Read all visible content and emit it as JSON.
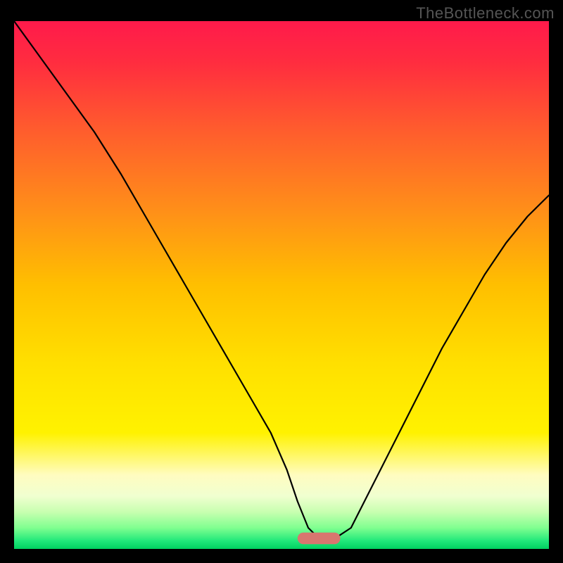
{
  "watermark": "TheBottleneck.com",
  "chart_data": {
    "type": "line",
    "title": "",
    "xlabel": "",
    "ylabel": "",
    "xlim": [
      0,
      100
    ],
    "ylim": [
      0,
      100
    ],
    "background_gradient": {
      "stops": [
        {
          "offset": 0.0,
          "color": "#ff1a4b"
        },
        {
          "offset": 0.08,
          "color": "#ff2d3f"
        },
        {
          "offset": 0.2,
          "color": "#ff5a2e"
        },
        {
          "offset": 0.35,
          "color": "#ff8c1a"
        },
        {
          "offset": 0.5,
          "color": "#ffbf00"
        },
        {
          "offset": 0.65,
          "color": "#ffe000"
        },
        {
          "offset": 0.78,
          "color": "#fff200"
        },
        {
          "offset": 0.86,
          "color": "#fffcc0"
        },
        {
          "offset": 0.9,
          "color": "#f0ffd0"
        },
        {
          "offset": 0.93,
          "color": "#c8ffb0"
        },
        {
          "offset": 0.96,
          "color": "#80ff90"
        },
        {
          "offset": 0.985,
          "color": "#20e87a"
        },
        {
          "offset": 1.0,
          "color": "#00d060"
        }
      ]
    },
    "marker": {
      "x": 57,
      "y": 2,
      "width": 8,
      "height": 2.2,
      "fill": "#d8766f",
      "rx": 1.1
    },
    "series": [
      {
        "name": "bottleneck-curve",
        "stroke": "#000000",
        "stroke_width": 2.2,
        "x": [
          0,
          5,
          10,
          15,
          20,
          24,
          28,
          32,
          36,
          40,
          44,
          48,
          51,
          53,
          55,
          57,
          60,
          63,
          65,
          68,
          72,
          76,
          80,
          84,
          88,
          92,
          96,
          100
        ],
        "y": [
          100,
          93,
          86,
          79,
          71,
          64,
          57,
          50,
          43,
          36,
          29,
          22,
          15,
          9,
          4,
          2.0,
          2.0,
          4,
          8,
          14,
          22,
          30,
          38,
          45,
          52,
          58,
          63,
          67
        ]
      }
    ]
  }
}
